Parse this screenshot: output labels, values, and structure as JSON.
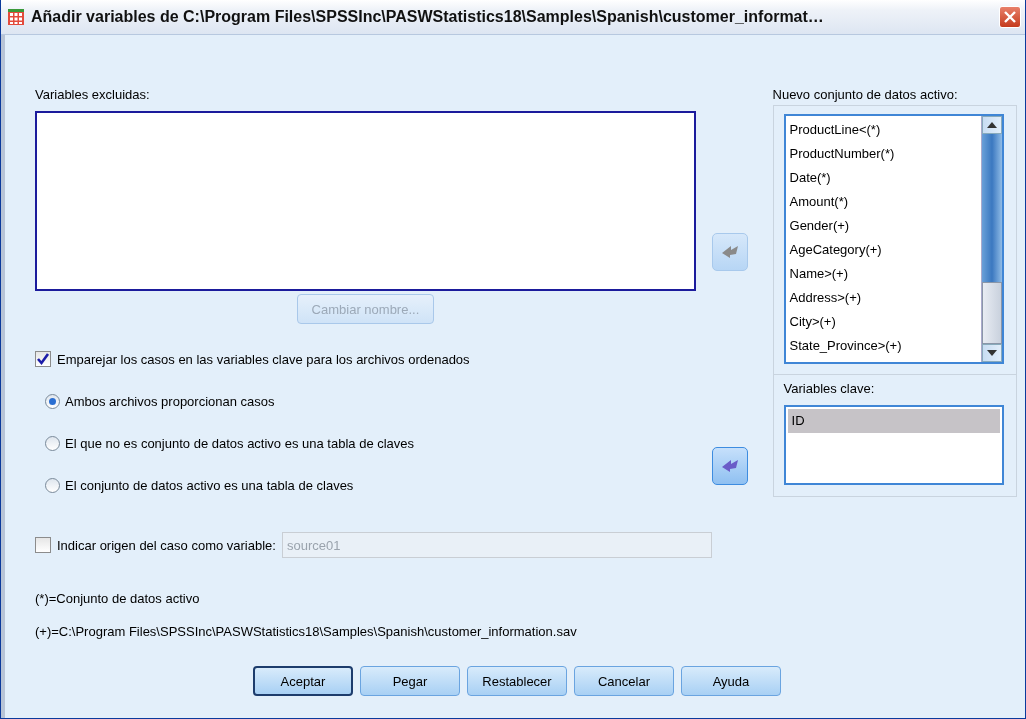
{
  "window": {
    "title": "Añadir variables de C:\\Program Files\\SPSSInc\\PASWStatistics18\\Samples\\Spanish\\customer_informat…"
  },
  "excluded": {
    "label": "Variables excluidas:"
  },
  "rename_button": {
    "label": "Cambiar nombre...",
    "disabled": true
  },
  "move_buttons": [
    {
      "disabled": true
    },
    {
      "disabled": false
    }
  ],
  "active_dataset": {
    "label": "Nuevo conjunto de datos activo:",
    "items": [
      {
        "text": "ProductLine<(*)"
      },
      {
        "text": "ProductNumber(*)"
      },
      {
        "text": "Date(*)"
      },
      {
        "text": "Amount(*)"
      },
      {
        "text": "Gender(+)"
      },
      {
        "text": "AgeCategory(+)"
      },
      {
        "text": "Name>(+)"
      },
      {
        "text": "Address>(+)"
      },
      {
        "text": "City>(+)"
      },
      {
        "text": "State_Province>(+)"
      }
    ]
  },
  "key_variables": {
    "label": "Variables clave:",
    "items": [
      {
        "text": "ID",
        "selected": true
      }
    ]
  },
  "match_checkbox": {
    "label": "Emparejar los casos en las variables clave para los archivos ordenados",
    "checked": true
  },
  "radios": [
    {
      "label": "Ambos archivos proporcionan casos",
      "selected": true
    },
    {
      "label": "El que no es conjunto de datos activo es una tabla de claves",
      "selected": false
    },
    {
      "label": "El conjunto de datos activo es una tabla de claves",
      "selected": false
    }
  ],
  "source_checkbox": {
    "label": "Indicar origen del caso como variable:",
    "checked": false,
    "value": "source01"
  },
  "notes": [
    "(*)=Conjunto de datos activo",
    "(+)=C:\\Program Files\\SPSSInc\\PASWStatistics18\\Samples\\Spanish\\customer_information.sav"
  ],
  "buttons": [
    {
      "label": "Aceptar",
      "default": true
    },
    {
      "label": "Pegar",
      "default": false
    },
    {
      "label": "Restablecer",
      "default": false
    },
    {
      "label": "Cancelar",
      "default": false
    },
    {
      "label": "Ayuda",
      "default": false
    }
  ]
}
